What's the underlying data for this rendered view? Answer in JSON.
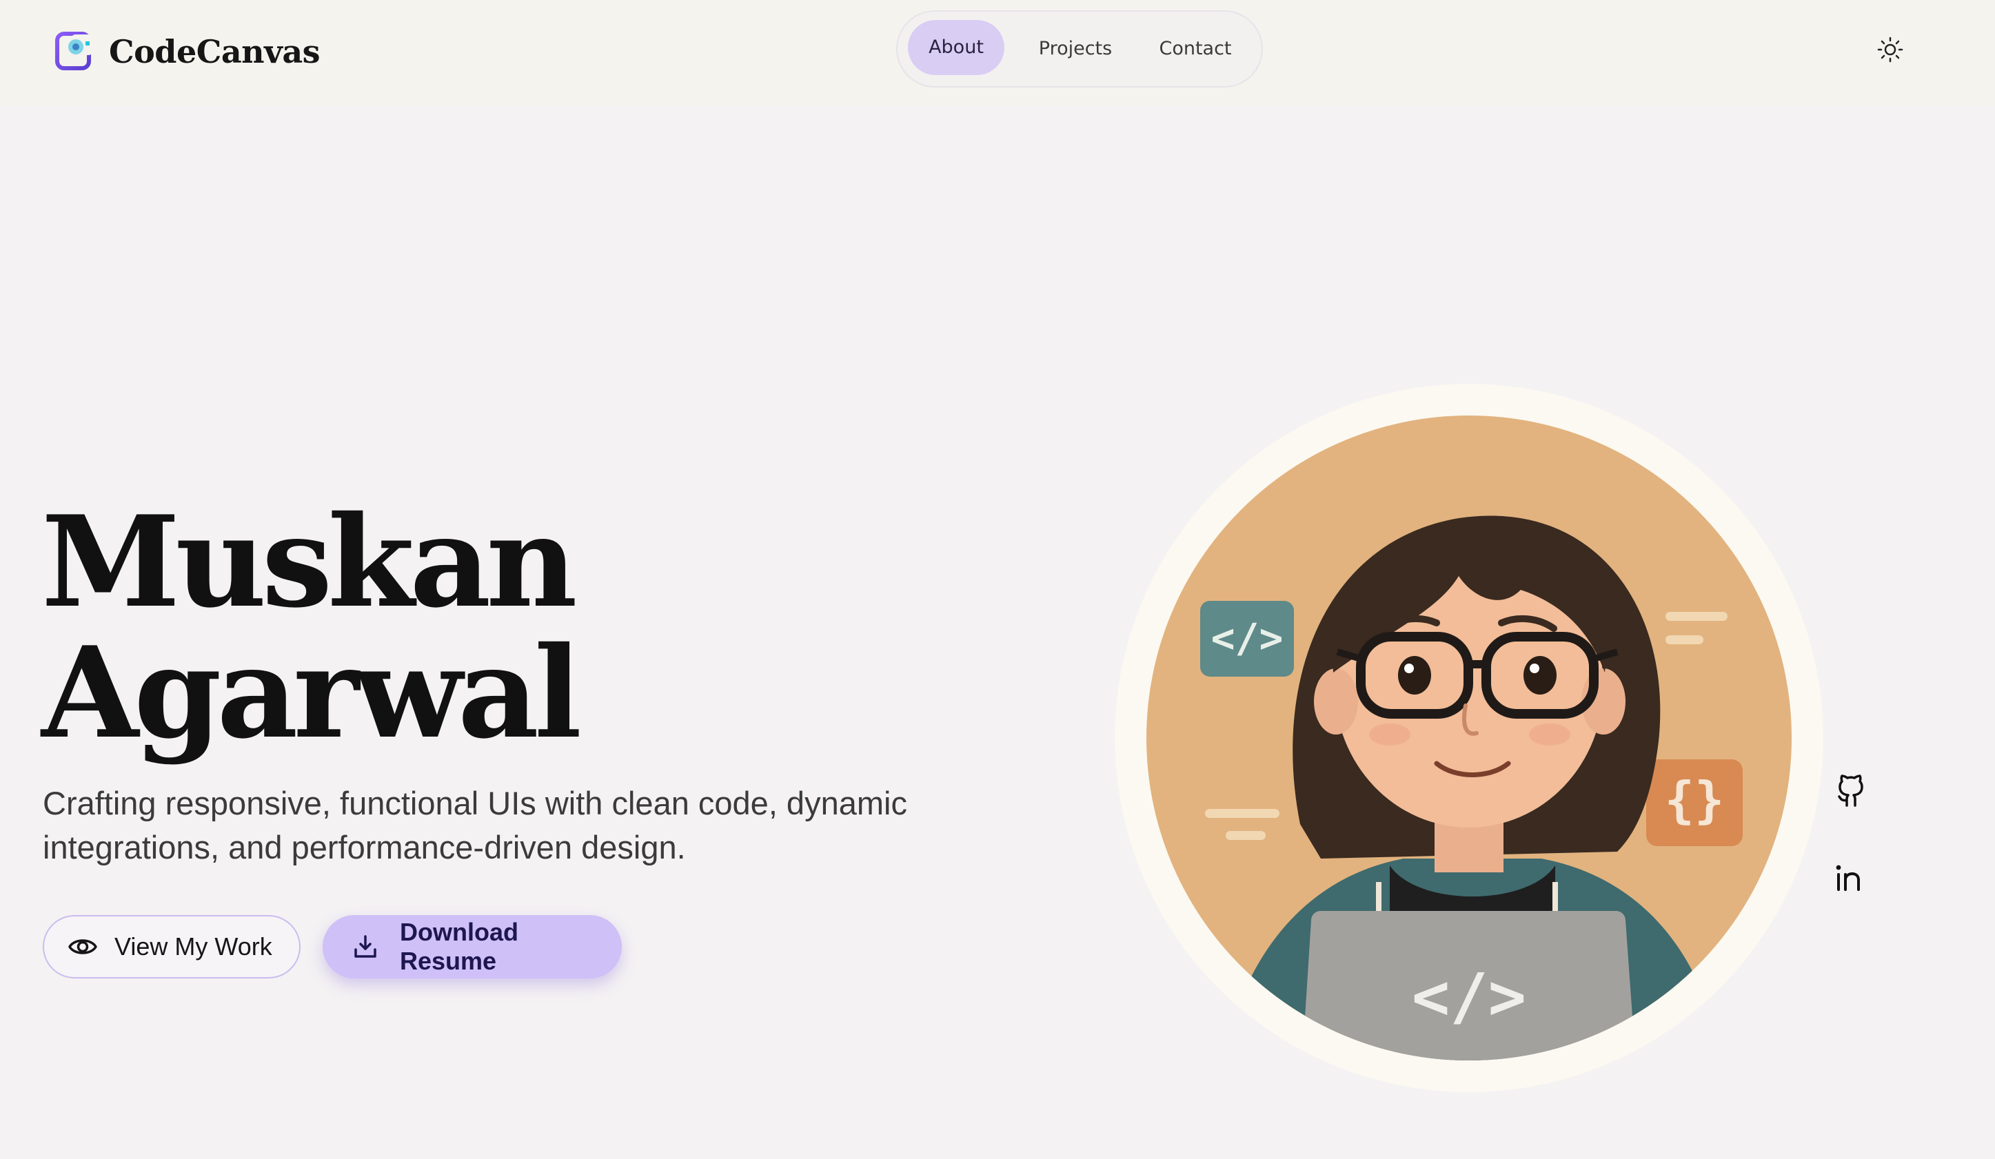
{
  "brand": {
    "name": "CodeCanvas",
    "logo_icon": "code-canvas-logo-icon"
  },
  "nav": {
    "items": [
      {
        "label": "About",
        "active": true
      },
      {
        "label": "Projects",
        "active": false
      },
      {
        "label": "Contact",
        "active": false
      }
    ]
  },
  "theme_toggle": {
    "icon": "sun-icon"
  },
  "hero": {
    "first_name": "Muskan",
    "last_name": "Agarwal",
    "subtitle": "Crafting responsive, functional UIs with clean code, dynamic integrations, and performance-driven design.",
    "primary_color": "#cfc0f7",
    "buttons": {
      "view_work": {
        "label": "View My Work",
        "icon": "eye-icon"
      },
      "download_resume": {
        "label": "Download Resume",
        "icon": "download-icon"
      }
    }
  },
  "avatar": {
    "illustration": "developer-avatar-illustration",
    "code_tag_text": "</>",
    "braces_text": "{}",
    "background_color": "#e2b37f",
    "ring_color": "#fbf9f1"
  },
  "socials": [
    {
      "name": "GitHub",
      "icon": "github-icon"
    },
    {
      "name": "LinkedIn",
      "icon": "linkedin-icon"
    }
  ]
}
